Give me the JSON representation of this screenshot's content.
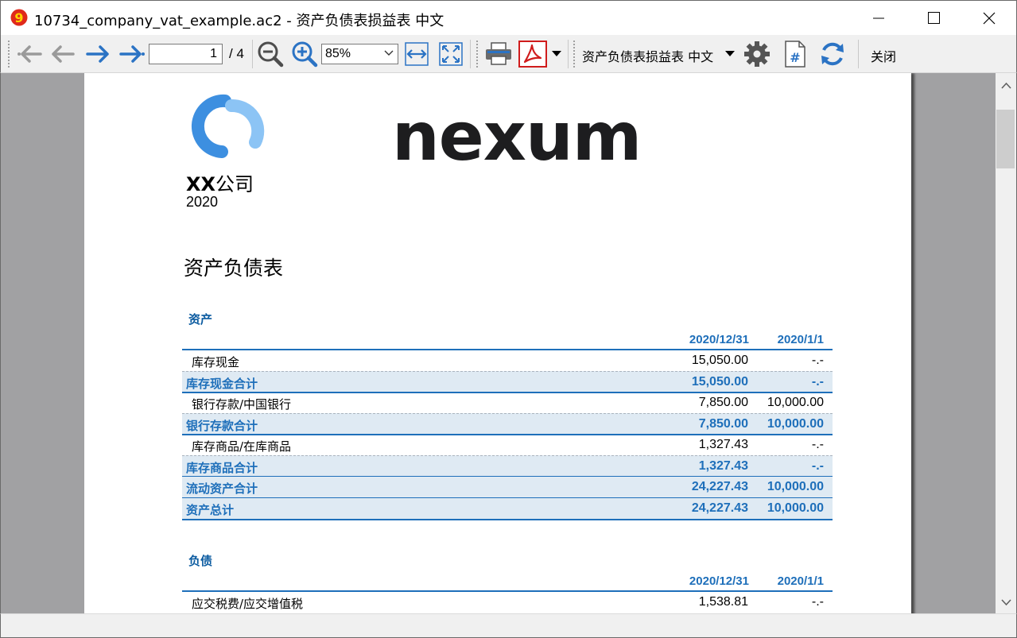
{
  "window": {
    "title": "10734_company_vat_example.ac2 - 资产负债表损益表 中文",
    "app_icon": "banana-nine-icon"
  },
  "toolbar": {
    "page_current": "1",
    "page_total": "/ 4",
    "zoom": "85%",
    "report_selector": "资产负债表损益表 中文",
    "close_label": "关闭"
  },
  "page": {
    "logo_text": "nexum",
    "company_bold": "XX",
    "company_rest": "公司",
    "year": "2020",
    "report_title": "资产负债表",
    "assets": {
      "section": "资产",
      "col1": "2020/12/31",
      "col2": "2020/1/1",
      "rows": [
        {
          "label": "库存现金",
          "v1": "15,050.00",
          "v2": "-.-",
          "total": false
        },
        {
          "label": "库存现金合计",
          "v1": "15,050.00",
          "v2": "-.-",
          "total": true
        },
        {
          "label": "银行存款/中国银行",
          "v1": "7,850.00",
          "v2": "10,000.00",
          "total": false
        },
        {
          "label": "银行存款合计",
          "v1": "7,850.00",
          "v2": "10,000.00",
          "total": true
        },
        {
          "label": "库存商品/在库商品",
          "v1": "1,327.43",
          "v2": "-.-",
          "total": false
        },
        {
          "label": "库存商品合计",
          "v1": "1,327.43",
          "v2": "-.-",
          "total": true
        },
        {
          "label": "流动资产合计",
          "v1": "24,227.43",
          "v2": "10,000.00",
          "total": true
        },
        {
          "label": "资产总计",
          "v1": "24,227.43",
          "v2": "10,000.00",
          "total": true
        }
      ]
    },
    "liabilities": {
      "section": "负债",
      "col1": "2020/12/31",
      "col2": "2020/1/1",
      "rows": [
        {
          "label": "应交税费/应交增值税",
          "v1": "1,538.81",
          "v2": "-.-",
          "total": false
        }
      ]
    }
  },
  "colors": {
    "accent_blue": "#1e6fba",
    "total_row_bg": "#dfeaf3",
    "viewer_bg": "#a1a1a3",
    "logo_blue": "#3d8fe0"
  }
}
